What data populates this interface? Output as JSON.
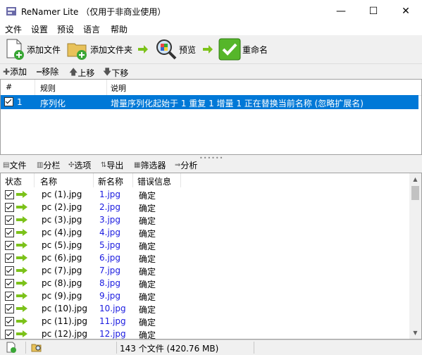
{
  "window": {
    "title": "ReNamer Lite  （仅用于非商业使用）"
  },
  "window_controls": {
    "minimize": "—",
    "maximize": "☐",
    "close": "✕"
  },
  "menu": [
    "文件",
    "设置",
    "预设",
    "语言",
    "帮助"
  ],
  "toolbar": {
    "add_files": "添加文件",
    "add_folders": "添加文件夹",
    "preview": "预览",
    "rename": "重命名"
  },
  "rules_toolbar": {
    "add": "添加",
    "remove": "移除",
    "up": "上移",
    "down": "下移"
  },
  "rules_table": {
    "headers": [
      "#",
      "规则",
      "说明"
    ],
    "rows": [
      {
        "num": "1",
        "rule": "序列化",
        "desc": "增量序列化起始于 1 重复 1 增量 1 正在替换当前名称 (忽略扩展名)"
      }
    ]
  },
  "files_toolbar": {
    "files": "文件",
    "columns": "分栏",
    "options": "选项",
    "export": "导出",
    "filter": "筛选器",
    "analyze": "分析"
  },
  "files_table": {
    "headers": [
      "状态",
      "名称",
      "新名称",
      "错误信息"
    ],
    "rows": [
      {
        "name": "pc (1).jpg",
        "new_name": "1.jpg",
        "error": "确定"
      },
      {
        "name": "pc (2).jpg",
        "new_name": "2.jpg",
        "error": "确定"
      },
      {
        "name": "pc (3).jpg",
        "new_name": "3.jpg",
        "error": "确定"
      },
      {
        "name": "pc (4).jpg",
        "new_name": "4.jpg",
        "error": "确定"
      },
      {
        "name": "pc (5).jpg",
        "new_name": "5.jpg",
        "error": "确定"
      },
      {
        "name": "pc (6).jpg",
        "new_name": "6.jpg",
        "error": "确定"
      },
      {
        "name": "pc (7).jpg",
        "new_name": "7.jpg",
        "error": "确定"
      },
      {
        "name": "pc (8).jpg",
        "new_name": "8.jpg",
        "error": "确定"
      },
      {
        "name": "pc (9).jpg",
        "new_name": "9.jpg",
        "error": "确定"
      },
      {
        "name": "pc (10).jpg",
        "new_name": "10.jpg",
        "error": "确定"
      },
      {
        "name": "pc (11).jpg",
        "new_name": "11.jpg",
        "error": "确定"
      },
      {
        "name": "pc (12).jpg",
        "new_name": "12.jpg",
        "error": "确定"
      }
    ]
  },
  "status": {
    "count": "143 个文件 (420.76 MB)"
  },
  "colors": {
    "selection": "#0078d7",
    "new_name": "#1a1ae0",
    "arrow_green": "#7cc21a"
  }
}
